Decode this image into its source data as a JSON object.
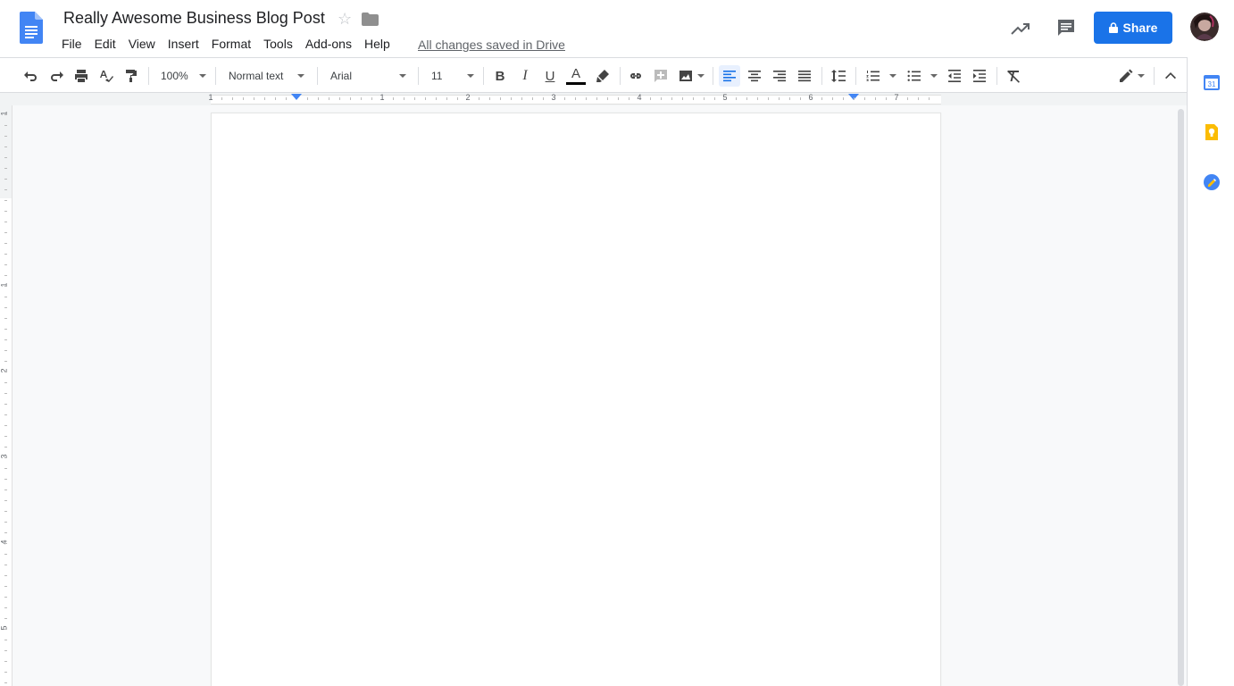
{
  "document": {
    "title": "Really Awesome Business Blog Post",
    "saved_status": "All changes saved in Drive"
  },
  "menu": {
    "items": [
      "File",
      "Edit",
      "View",
      "Insert",
      "Format",
      "Tools",
      "Add-ons",
      "Help"
    ]
  },
  "header": {
    "share_label": "Share"
  },
  "toolbar": {
    "zoom": "100%",
    "style": "Normal text",
    "font": "Arial",
    "font_size": "11",
    "bold_label": "B",
    "italic_label": "I",
    "underline_label": "U",
    "text_color_label": "A"
  },
  "ruler": {
    "horizontal_numbers": [
      "1",
      "1",
      "2",
      "3",
      "4",
      "5",
      "6",
      "7"
    ],
    "vertical_numbers": [
      "1",
      "1",
      "2",
      "3",
      "4",
      "5"
    ]
  },
  "icons": {
    "docs": "docs-logo-icon",
    "star": "star-icon",
    "folder": "folder-icon",
    "activity": "activity-trend-icon",
    "comments": "comments-icon",
    "calendar": "calendar-icon",
    "keep": "keep-icon",
    "tasks": "tasks-icon"
  },
  "colors": {
    "accent": "#1a73e8",
    "docs_blue": "#4285f4",
    "calendar_day": "31"
  }
}
